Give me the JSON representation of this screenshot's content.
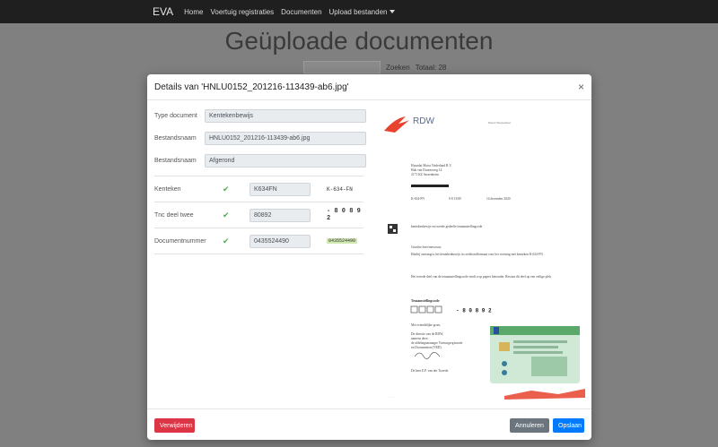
{
  "navbar": {
    "brand": "EVA",
    "links": [
      "Home",
      "Voertuig registraties",
      "Documenten",
      "Upload bestanden"
    ]
  },
  "page": {
    "title": "Geüploade documenten",
    "search_button": "Zoeken",
    "total": "Totaal: 28"
  },
  "modal": {
    "title": "Details van 'HNLU0152_201216-113439-ab6.jpg'",
    "close": "×",
    "fields": [
      {
        "label": "Type document",
        "value": "Kentekenbewijs"
      },
      {
        "label": "Bestandsnaam",
        "value": "HNLU0152_201216-113439-ab6.jpg"
      },
      {
        "label": "Bestandsnaam",
        "value": "Afgerond"
      }
    ],
    "extracted": [
      {
        "label": "Kenteken",
        "value": "K634FN",
        "snippet": "K-634-FN"
      },
      {
        "label": "Tnc deel twee",
        "value": "80892",
        "snippet": "- 8 0 8 9 2"
      },
      {
        "label": "Documentnummer",
        "value": "0435524490",
        "snippet": "0435524490"
      }
    ],
    "footer": {
      "delete": "Verwijderen",
      "cancel": "Annuleren",
      "save": "Opslaan"
    }
  },
  "document": {
    "logo": "RDW",
    "header_note": "Dienst Wegverkeer",
    "address": [
      "Hyundai Motor Nederland B.V.",
      "Hub van Doorneweg 14",
      "2171 KZ  Sassenheim"
    ],
    "meta": [
      "K-634-FN",
      "0 8 13/09",
      "14 december 2020"
    ],
    "subject": "kentekenbewijs en tweede gedeelte tenaamstellingcode",
    "greeting": "Geachte  heer/mevrouw,",
    "para1": "Hierbij  ontvangt u het kentekenbewijs in creditcardformaat voor het voertuig met kenteken K-634-FN.",
    "para2": "Het tweede deel van de tenaamstellingscode vindt u op papier hieronder. Bewaar dit deel op een veilige plek.",
    "code_label": "Tenaamstellingscode",
    "code": "- 8 0 8 9 2",
    "closing": [
      "Met vriendelijke groet,",
      "De directie van de RDW,",
      "namens deze,",
      "de afdelingsmanager Voertuigregistratie",
      "en Documenten (VRD)."
    ],
    "signature": "De heer E.P. van der Tweede"
  }
}
